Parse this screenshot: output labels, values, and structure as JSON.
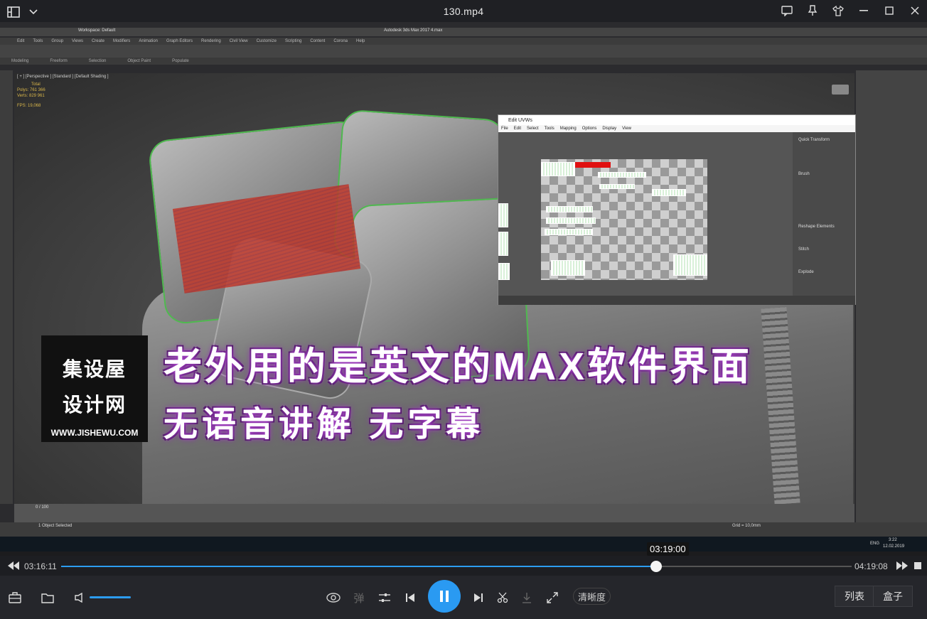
{
  "player": {
    "title": "130.mp4",
    "current_time": "03:16:11",
    "total_time": "04:19:08",
    "hover_time": "03:19:00",
    "progress": 0.753,
    "volume": 0.7,
    "quality_label": "清晰度",
    "danmu_label": "弹",
    "playlist_label": "列表",
    "box_label": "盒子",
    "accent": "#2c9cf0"
  },
  "max_ui": {
    "app_title": "Autodesk 3ds Max 2017    4.max",
    "workspace": "Workspace: Default",
    "menu": [
      "Edit",
      "Tools",
      "Group",
      "Views",
      "Create",
      "Modifiers",
      "Animation",
      "Graph Editors",
      "Rendering",
      "Civil View",
      "Customize",
      "Scripting",
      "Content",
      "Corona",
      "Help"
    ],
    "ribbon_tabs": [
      "Modeling",
      "Freeform",
      "Selection",
      "Object Paint",
      "Populate"
    ],
    "viewport_label": "[ + ] [Perspective ] [Standard ] [Default Shading ]",
    "stats": [
      "Total",
      "Polys:  761 366",
      "Verts:  829 961",
      "FPS:   19,068"
    ],
    "uvw": {
      "title": "Edit UVWs",
      "menu": [
        "File",
        "Edit",
        "Select",
        "Tools",
        "Mapping",
        "Options",
        "Display",
        "View"
      ],
      "panels": [
        "Quick Transform",
        "Brush",
        "Reshape Elements",
        "Stitch",
        "Explode"
      ]
    },
    "status_selected": "1 Object Selected",
    "grid": "Grid = 10,0mm",
    "frame": "0 / 100",
    "clock": "3:22",
    "date": "12.02.2019",
    "lang": "ENG"
  },
  "overlay": {
    "logo_line1": "集设屋",
    "logo_line2": "设计网",
    "logo_url": "WWW.JISHEWU.COM",
    "caption1": "老外用的是英文的MAX软件界面",
    "caption2": "无语音讲解  无字幕"
  }
}
